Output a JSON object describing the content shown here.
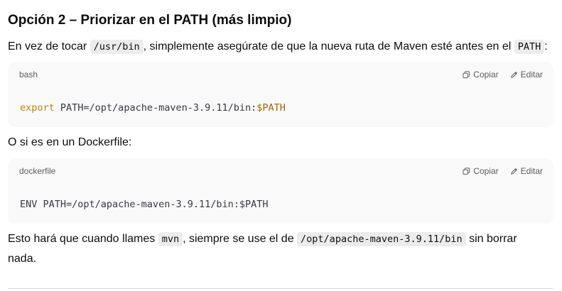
{
  "heading": "Opción 2 – Priorizar en el PATH (más limpio)",
  "paragraph1": {
    "t1": "En vez de tocar ",
    "code1": "/usr/bin",
    "t2": ", simplemente asegúrate de que la nueva ruta de Maven esté antes en el ",
    "code2": "PATH",
    "t3": ":"
  },
  "codeblock1": {
    "language": "bash",
    "copy_label": "Copiar",
    "edit_label": "Editar",
    "keyword": "export",
    "text": " PATH=/opt/apache-maven-3.9.11/bin:",
    "variable": "$PATH"
  },
  "paragraph2": "O si es en un Dockerfile:",
  "codeblock2": {
    "language": "dockerfile",
    "copy_label": "Copiar",
    "edit_label": "Editar",
    "code": "ENV PATH=/opt/apache-maven-3.9.11/bin:$PATH"
  },
  "paragraph3": {
    "t1": "Esto hará que cuando llames ",
    "code1": "mvn",
    "t2": ", siempre se use el de ",
    "code2": "/opt/apache-maven-3.9.11/bin",
    "t3": " sin borrar nada."
  },
  "icons": {
    "copy": "copy-icon",
    "edit": "edit-icon"
  },
  "colors": {
    "keyword": "#c18401",
    "variable": "#a06800",
    "codeblock_bg": "#f9f9f9",
    "inline_code_bg": "#ececec"
  }
}
